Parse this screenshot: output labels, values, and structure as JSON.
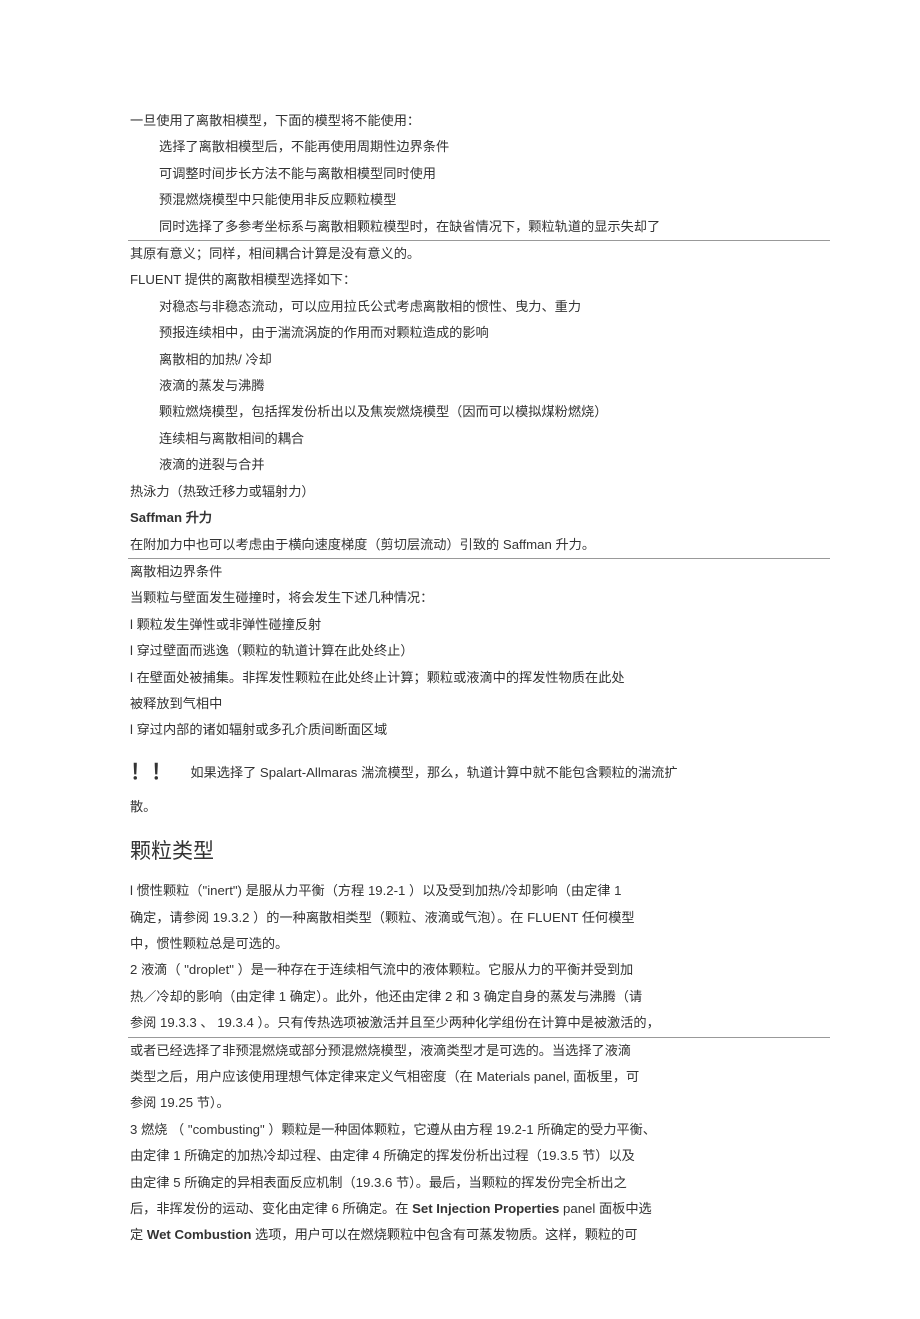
{
  "head1": "一旦使用了离散相模型，下面的模型将不能使用：",
  "b1": "选择了离散相模型后，不能再使用周期性边界条件",
  "b2": "可调整时间步长方法不能与离散相模型同时使用",
  "b3": "预混燃烧模型中只能使用非反应颗粒模型",
  "b4": "同时选择了多参考坐标系与离散相颗粒模型时，在缺省情况下，颗粒轨道的显示失却了",
  "b5": "其原有意义；同样，相间耦合计算是没有意义的。",
  "head2": "FLUENT 提供的离散相模型选择如下：",
  "c1": "对稳态与非稳态流动，可以应用拉氏公式考虑离散相的惯性、曳力、重力",
  "c2": "预报连续相中，由于湍流涡旋的作用而对颗粒造成的影响",
  "c3": "离散相的加热/ 冷却",
  "c4": "液滴的蒸发与沸腾",
  "c5": "颗粒燃烧模型，包括挥发份析出以及焦炭燃烧模型（因而可以模拟煤粉燃烧）",
  "c6": "连续相与离散相间的耦合",
  "c7": "液滴的迸裂与合并",
  "t1": "热泳力（热致迁移力或辐射力）",
  "saff_h": "Saffman 升力",
  "saff_p": "在附加力中也可以考虑由于横向速度梯度（剪切层流动）引致的 Saffman 升力。",
  "bc1": "离散相边界条件",
  "bc2": "当颗粒与壁面发生碰撞时，将会发生下述几种情况：",
  "bc3": "l 颗粒发生弹性或非弹性碰撞反射",
  "bc4": "l 穿过壁面而逃逸（颗粒的轨道计算在此处终止）",
  "bc5": "l 在壁面处被捕集。非挥发性颗粒在此处终止计算；颗粒或液滴中的挥发性物质在此处",
  "bc6": "被释放到气相中",
  "bc7": "l 穿过内部的诸如辐射或多孔介质间断面区域",
  "warn_mark": "！！",
  "warn_t": "如果选择了 Spalart-Allmaras 湍流模型，那么，轨道计算中就不能包含颗粒的湍流扩",
  "warn_t2": "散。",
  "sec_h": "颗粒类型",
  "p1a": "l 惯性颗粒（\"inert\") 是服从力平衡（方程 19.2-1 ）以及受到加热/冷却影响（由定律 1",
  "p1b": "确定，请参阅 19.3.2 ）的一种离散相类型（颗粒、液滴或气泡）。在 FLUENT 任何模型",
  "p1c": "中，惯性颗粒总是可选的。",
  "p2a": "2  液滴（ \"droplet\" ）是一种存在于连续相气流中的液体颗粒。它服从力的平衡并受到加",
  "p2b": "热／冷却的影响（由定律  1 确定）。此外，他还由定律  2 和 3 确定自身的蒸发与沸腾（请",
  "p2c": "参阅  19.3.3 、  19.3.4 ）。只有传热选项被激活并且至少两种化学组份在计算中是被激活的，",
  "p2d": "或者已经选择了非预混燃烧或部分预混燃烧模型，液滴类型才是可选的。当选择了液滴",
  "p2e": "类型之后，用户应该使用理想气体定律来定义气相密度（在 Materials panel, 面板里，可",
  "p2f": "参阅  19.25 节）。",
  "p3a": "3  燃烧 （ \"combusting\" ）颗粒是一种固体颗粒，它遵从由方程 19.2-1 所确定的受力平衡、",
  "p3b": "由定律 1 所确定的加热冷却过程、由定律 4 所确定的挥发份析出过程（19.3.5 节）以及",
  "p3c": "由定律 5 所确定的异相表面反应机制（19.3.6 节）。最后，当颗粒的挥发份完全析出之",
  "p3d_a": "后，非挥发份的运动、变化由定律  6 所确定。在 ",
  "p3d_b": "Set Injection Properties",
  "p3d_c": " panel 面板中选",
  "p3e_a": "定 ",
  "p3e_b": "Wet Combustion",
  "p3e_c": " 选项，用户可以在燃烧颗粒中包含有可蒸发物质。这样，颗粒的可"
}
